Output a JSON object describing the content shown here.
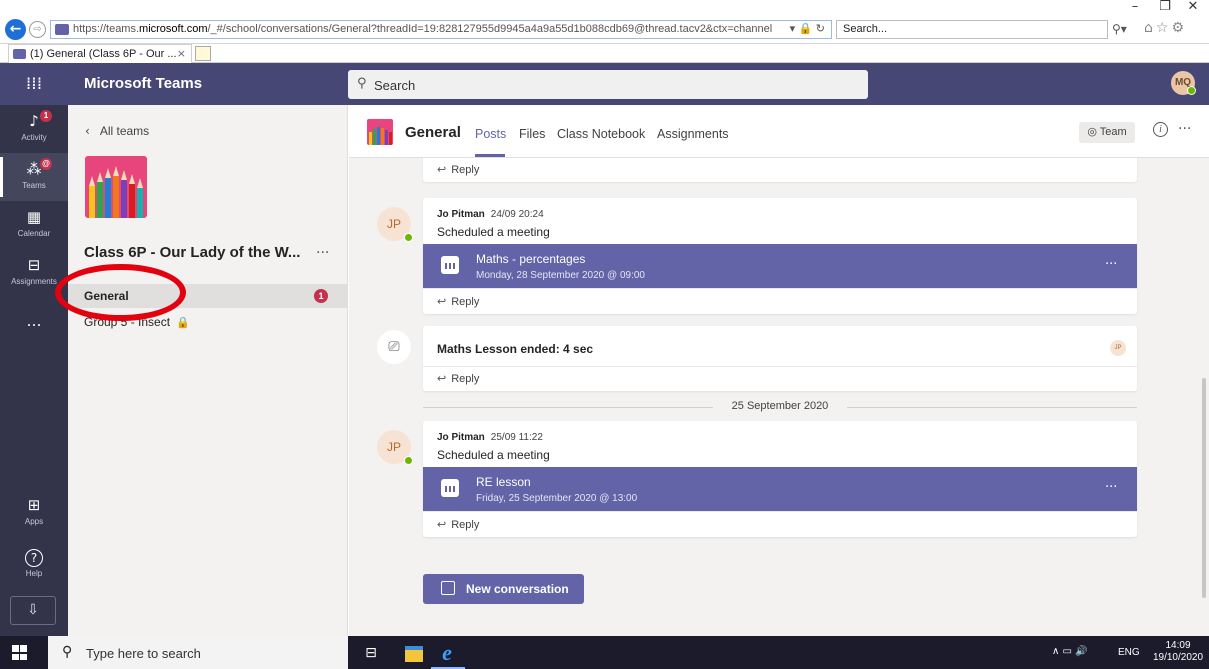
{
  "browser": {
    "url_prefix": "https://teams.",
    "url_domain": "microsoft.com",
    "url_rest": "/_#/school/conversations/General?threadId=19:828127955d9945a4a9a55d1b088cdb69@thread.tacv2&ctx=channel",
    "address_icons": "▾ 🔒 ↻",
    "search_placeholder": "Search...",
    "tab_title": "(1) General (Class 6P - Our ...",
    "minimize_glyph": "–",
    "restore_glyph": "❐",
    "close_glyph": "✕"
  },
  "header": {
    "app_name": "Microsoft Teams",
    "search_placeholder": "Search",
    "user_initials": "MQ"
  },
  "rail": {
    "items": [
      {
        "label": "Activity",
        "icon": "bell-icon",
        "glyph": "🔔",
        "badge": "1"
      },
      {
        "label": "Teams",
        "icon": "teams-icon",
        "glyph": "⁂",
        "badge": "@"
      },
      {
        "label": "Calendar",
        "icon": "calendar-icon",
        "glyph": "▦"
      },
      {
        "label": "Assignments",
        "icon": "assignments-icon",
        "glyph": "🎒"
      },
      {
        "label": "",
        "icon": "more-icon",
        "glyph": "…"
      },
      {
        "label": "Apps",
        "icon": "apps-icon",
        "glyph": "⊞"
      },
      {
        "label": "Help",
        "icon": "help-icon",
        "glyph": "?"
      }
    ],
    "download_glyph": "⇩"
  },
  "team_panel": {
    "back_label": "All teams",
    "team_name": "Class 6P - Our Lady of the W...",
    "channels": [
      {
        "label": "General",
        "badge": "1"
      },
      {
        "label": "Group 5 - Insect",
        "lock": "🔒"
      }
    ]
  },
  "channel_header": {
    "title": "General",
    "tabs": [
      "Posts",
      "Files",
      "Class Notebook",
      "Assignments"
    ],
    "team_button": "◎ Team",
    "info": "i",
    "more": "···"
  },
  "conversation": {
    "reply_label": "Reply",
    "messages": [
      {
        "author": "Jo Pitman",
        "initials": "JP",
        "time": "24/09 20:24",
        "text": "Scheduled a meeting",
        "meeting_title": "Maths - percentages",
        "meeting_time": "Monday, 28 September 2020 @ 09:00"
      },
      {
        "event": "Maths Lesson ended: 4 sec",
        "initials": "JP"
      },
      {
        "author": "Jo Pitman",
        "initials": "JP",
        "time": "25/09 11:22",
        "text": "Scheduled a meeting",
        "meeting_title": "RE lesson",
        "meeting_time": "Friday, 25 September 2020 @ 13:00"
      }
    ],
    "date_separator": "25 September 2020",
    "new_conversation": "New conversation"
  },
  "taskbar": {
    "search_placeholder": "Type here to search",
    "tray": "∧ ▭ 🔊",
    "lang": "ENG",
    "time": "14:09",
    "date": "19/10/2020"
  },
  "colors": {
    "teams_purple": "#6264a7",
    "header": "#464775",
    "rail": "#33344a",
    "badge_red": "#c4314b",
    "annotation_red": "#e3000f"
  }
}
